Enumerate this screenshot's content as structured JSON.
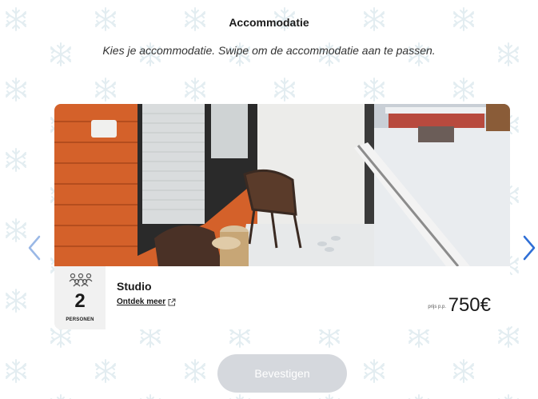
{
  "header": {
    "title": "Accommodatie",
    "subtitle": "Kies je accommodatie. Swipe om de accommodatie aan te passen."
  },
  "accommodation": {
    "persons_count": "2",
    "persons_label": "PERSONEN",
    "name": "Studio",
    "discover_link": "Ontdek meer",
    "price_prefix": "prijs p.p.",
    "price": "750€"
  },
  "icons": {
    "persons": "people-group-icon",
    "external": "external-link-icon",
    "prev": "chevron-left-icon",
    "next": "chevron-right-icon",
    "background": "snowflake-icon"
  },
  "footer": {
    "confirm_label": "Bevestigen"
  },
  "colors": {
    "accent": "#2f6fd6",
    "button_disabled": "#d5d8dd",
    "snowflake": "#e5eef2",
    "wood": "#d4612a"
  }
}
